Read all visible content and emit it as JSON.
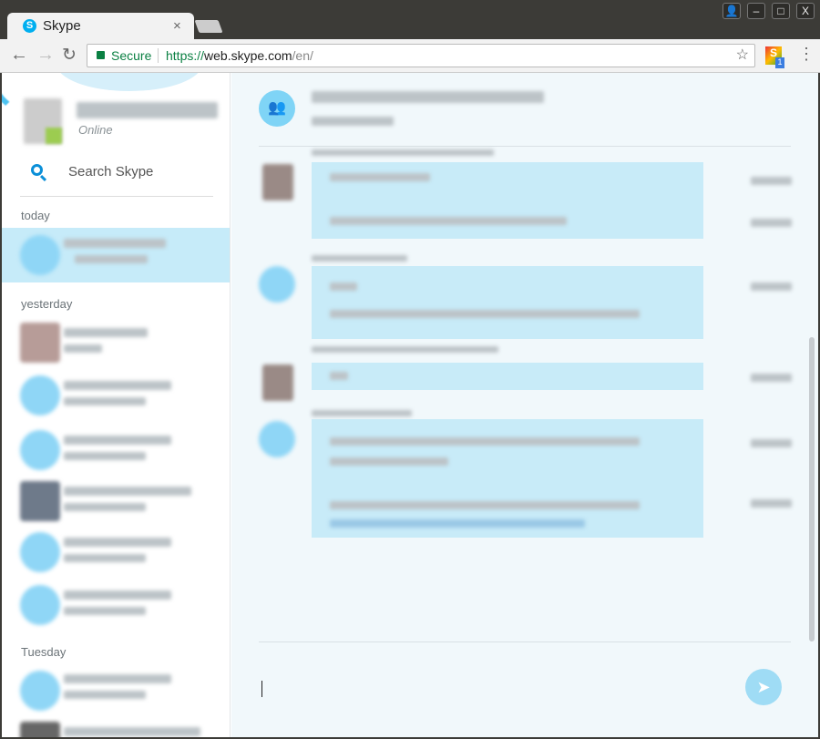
{
  "browser": {
    "tab_title": "Skype",
    "tab_close": "×",
    "secure_label": "Secure",
    "url_scheme": "https://",
    "url_host": "web.skype.com",
    "url_path": "/en/",
    "extension_badge": "1",
    "window_buttons": [
      "👤",
      "–",
      "□",
      "X"
    ]
  },
  "sidebar": {
    "status": "Online",
    "search_placeholder": "Search Skype",
    "sections": [
      "today",
      "yesterday",
      "Tuesday"
    ]
  },
  "colors": {
    "accent": "#00aff0",
    "selected": "#c6ebf9",
    "bubble": "#c8ebf8",
    "send": "#9fdcf5"
  }
}
